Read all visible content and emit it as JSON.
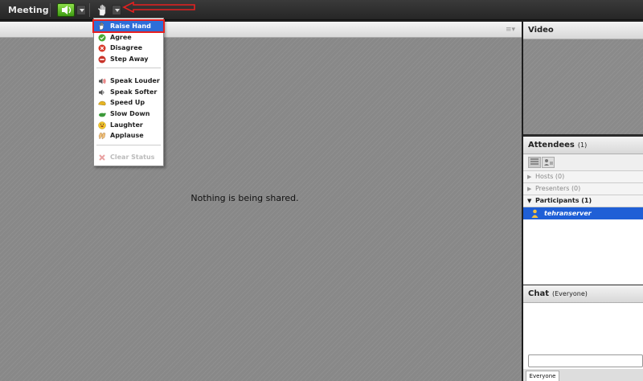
{
  "topbar": {
    "meeting_label": "Meeting"
  },
  "status_menu": {
    "items": [
      {
        "label": "Raise Hand",
        "icon": "raise-hand-icon",
        "state": "selected"
      },
      {
        "label": "Agree",
        "icon": "agree-icon"
      },
      {
        "label": "Disagree",
        "icon": "disagree-icon"
      },
      {
        "label": "Step Away",
        "icon": "step-away-icon"
      },
      {
        "label": "Speak Louder",
        "icon": "speak-louder-icon"
      },
      {
        "label": "Speak Softer",
        "icon": "speak-softer-icon"
      },
      {
        "label": "Speed Up",
        "icon": "speed-up-icon"
      },
      {
        "label": "Slow Down",
        "icon": "slow-down-icon"
      },
      {
        "label": "Laughter",
        "icon": "laughter-icon"
      },
      {
        "label": "Applause",
        "icon": "applause-icon"
      },
      {
        "label": "Clear Status",
        "icon": "clear-status-icon",
        "state": "disabled"
      }
    ]
  },
  "share": {
    "empty_message": "Nothing is being shared."
  },
  "video": {
    "title": "Video"
  },
  "attendees": {
    "title": "Attendees",
    "count": "(1)",
    "groups": [
      {
        "label": "Hosts (0)",
        "expanded": false
      },
      {
        "label": "Presenters (0)",
        "expanded": false
      },
      {
        "label": "Participants (1)",
        "expanded": true
      }
    ],
    "users": [
      {
        "name": "tehranserver",
        "status": "raise-hand"
      }
    ]
  },
  "chat": {
    "title": "Chat",
    "audience": "(Everyone)",
    "tab_label": "Everyone"
  },
  "colors": {
    "selection_blue": "#2e6ed8",
    "highlight_red": "#e82020",
    "audio_green": "#5cc024"
  }
}
